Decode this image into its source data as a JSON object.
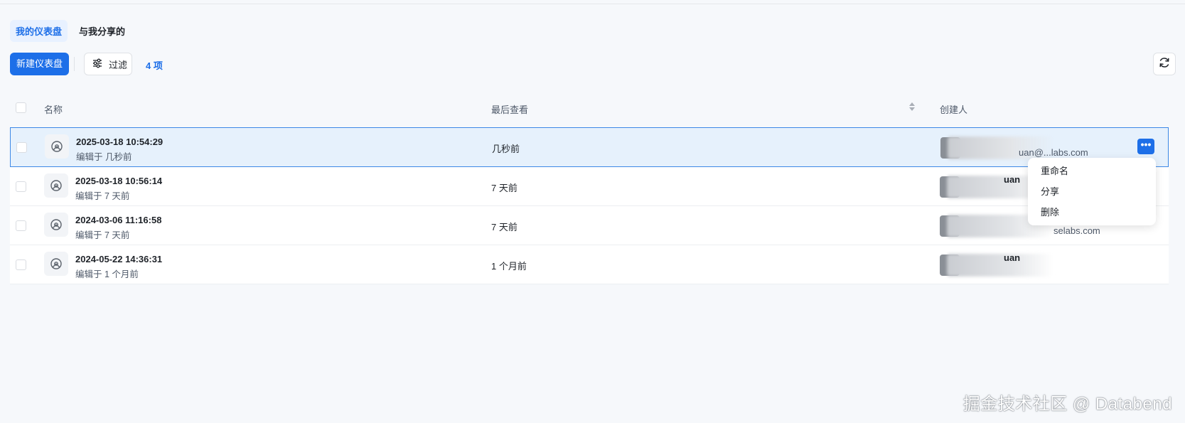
{
  "tabs": [
    {
      "label": "我的仪表盘",
      "active": true
    },
    {
      "label": "与我分享的",
      "active": false
    }
  ],
  "toolbar": {
    "new_label": "新建仪表盘",
    "filter_label": "过滤",
    "count_label": "4 项"
  },
  "table": {
    "columns": {
      "name": "名称",
      "last_viewed": "最后查看",
      "creator": "创建人"
    },
    "rows": [
      {
        "name": "2025-03-18 10:54:29",
        "edited": "编辑于 几秒前",
        "last_viewed": "几秒前",
        "creator_name": "",
        "creator_email": "uan@...labs.com",
        "selected": true
      },
      {
        "name": "2025-03-18 10:56:14",
        "edited": "编辑于 7 天前",
        "last_viewed": "7 天前",
        "creator_name": "uan",
        "creator_email": "",
        "selected": false
      },
      {
        "name": "2024-03-06 11:16:58",
        "edited": "编辑于 7 天前",
        "last_viewed": "7 天前",
        "creator_name": "",
        "creator_email": "selabs.com",
        "selected": false
      },
      {
        "name": "2024-05-22 14:36:31",
        "edited": "编辑于 1 个月前",
        "last_viewed": "1 个月前",
        "creator_name": "uan",
        "creator_email": "",
        "selected": false
      }
    ]
  },
  "context_menu": {
    "items": [
      "重命名",
      "分享",
      "删除"
    ]
  },
  "more_button_label": "•••",
  "watermark": "掘金技术社区 @ Databend",
  "colors": {
    "accent": "#1d6fe8",
    "selected_row_bg": "#e6f1fc",
    "selected_row_border": "#3d88e6",
    "page_bg": "#f6f8fb"
  }
}
